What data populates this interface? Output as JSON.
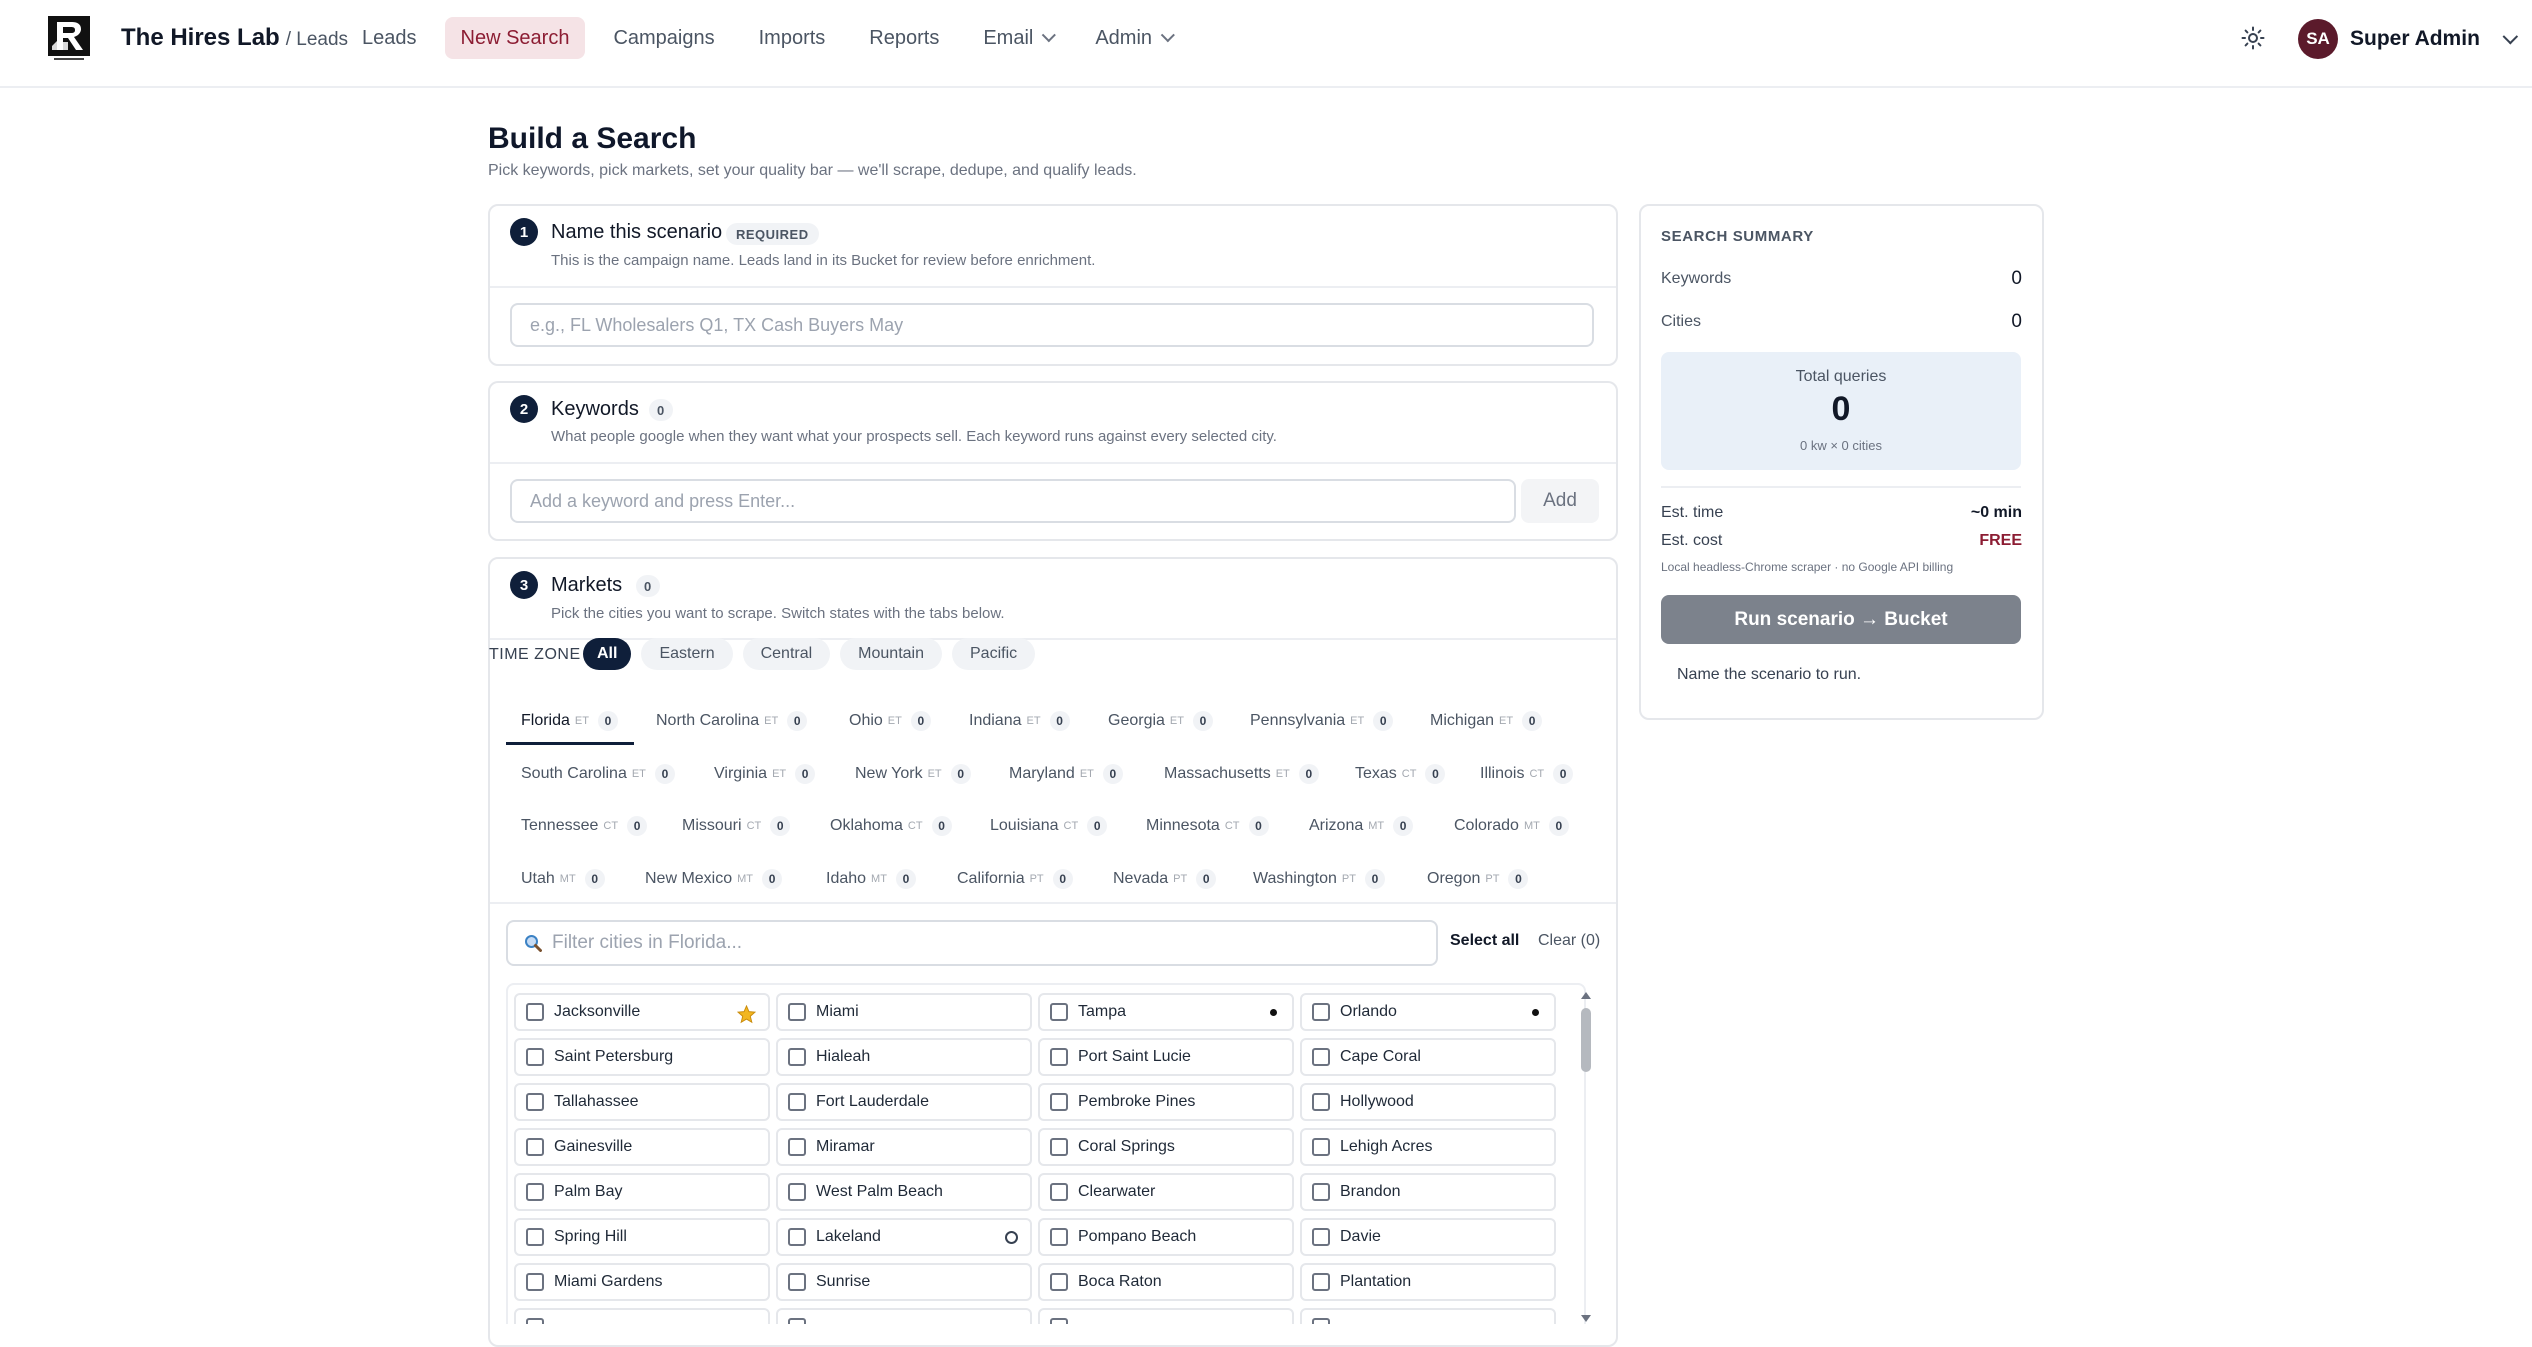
{
  "header": {
    "brand": "The Hires Lab",
    "brand_sub": "/ Leads",
    "nav": [
      {
        "label": "Leads"
      },
      {
        "label": "New Search",
        "active": true
      },
      {
        "label": "Campaigns"
      },
      {
        "label": "Imports"
      },
      {
        "label": "Reports"
      },
      {
        "label": "Email",
        "dropdown": true
      },
      {
        "label": "Admin",
        "dropdown": true
      }
    ],
    "theme_icon": "sun-icon",
    "user": {
      "initials": "SA",
      "name": "Super Admin"
    }
  },
  "page": {
    "title": "Build a Search",
    "subtitle": "Pick keywords, pick markets, set your quality bar — we'll scrape, dedupe, and qualify leads."
  },
  "step1": {
    "num": "1",
    "title": "Name this scenario",
    "badge": "REQUIRED",
    "desc": "This is the campaign name. Leads land in its Bucket for review before enrichment.",
    "placeholder": "e.g., FL Wholesalers Q1, TX Cash Buyers May"
  },
  "step2": {
    "num": "2",
    "title": "Keywords",
    "count": "0",
    "desc": "What people google when they want what your prospects sell. Each keyword runs against every selected city.",
    "placeholder": "Add a keyword and press Enter...",
    "add_label": "Add"
  },
  "step3": {
    "num": "3",
    "title": "Markets",
    "count": "0",
    "desc": "Pick the cities you want to scrape. Switch states with the tabs below.",
    "tz_label": "TIME ZONE",
    "timezones": [
      "All",
      "Eastern",
      "Central",
      "Mountain",
      "Pacific"
    ],
    "states": [
      {
        "name": "Florida",
        "tz": "ET",
        "count": "0"
      },
      {
        "name": "North Carolina",
        "tz": "ET",
        "count": "0"
      },
      {
        "name": "Ohio",
        "tz": "ET",
        "count": "0"
      },
      {
        "name": "Indiana",
        "tz": "ET",
        "count": "0"
      },
      {
        "name": "Georgia",
        "tz": "ET",
        "count": "0"
      },
      {
        "name": "Pennsylvania",
        "tz": "ET",
        "count": "0"
      },
      {
        "name": "Michigan",
        "tz": "ET",
        "count": "0"
      },
      {
        "name": "South Carolina",
        "tz": "ET",
        "count": "0"
      },
      {
        "name": "Virginia",
        "tz": "ET",
        "count": "0"
      },
      {
        "name": "New York",
        "tz": "ET",
        "count": "0"
      },
      {
        "name": "Maryland",
        "tz": "ET",
        "count": "0"
      },
      {
        "name": "Massachusetts",
        "tz": "ET",
        "count": "0"
      },
      {
        "name": "Texas",
        "tz": "CT",
        "count": "0"
      },
      {
        "name": "Illinois",
        "tz": "CT",
        "count": "0"
      },
      {
        "name": "Tennessee",
        "tz": "CT",
        "count": "0"
      },
      {
        "name": "Missouri",
        "tz": "CT",
        "count": "0"
      },
      {
        "name": "Oklahoma",
        "tz": "CT",
        "count": "0"
      },
      {
        "name": "Louisiana",
        "tz": "CT",
        "count": "0"
      },
      {
        "name": "Minnesota",
        "tz": "CT",
        "count": "0"
      },
      {
        "name": "Arizona",
        "tz": "MT",
        "count": "0"
      },
      {
        "name": "Colorado",
        "tz": "MT",
        "count": "0"
      },
      {
        "name": "Utah",
        "tz": "MT",
        "count": "0"
      },
      {
        "name": "New Mexico",
        "tz": "MT",
        "count": "0"
      },
      {
        "name": "Idaho",
        "tz": "MT",
        "count": "0"
      },
      {
        "name": "California",
        "tz": "PT",
        "count": "0"
      },
      {
        "name": "Nevada",
        "tz": "PT",
        "count": "0"
      },
      {
        "name": "Washington",
        "tz": "PT",
        "count": "0"
      },
      {
        "name": "Oregon",
        "tz": "PT",
        "count": "0"
      }
    ],
    "filter_placeholder": "Filter cities in Florida...",
    "select_all": "Select all",
    "clear": "Clear (0)",
    "cities": [
      {
        "name": "Jacksonville",
        "mark": "star-icon"
      },
      {
        "name": "Miami"
      },
      {
        "name": "Tampa",
        "mark": "dot-icon"
      },
      {
        "name": "Orlando",
        "mark": "dot-icon"
      },
      {
        "name": "Saint Petersburg"
      },
      {
        "name": "Hialeah"
      },
      {
        "name": "Port Saint Lucie"
      },
      {
        "name": "Cape Coral"
      },
      {
        "name": "Tallahassee"
      },
      {
        "name": "Fort Lauderdale"
      },
      {
        "name": "Pembroke Pines"
      },
      {
        "name": "Hollywood"
      },
      {
        "name": "Gainesville"
      },
      {
        "name": "Miramar"
      },
      {
        "name": "Coral Springs"
      },
      {
        "name": "Lehigh Acres"
      },
      {
        "name": "Palm Bay"
      },
      {
        "name": "West Palm Beach"
      },
      {
        "name": "Clearwater"
      },
      {
        "name": "Brandon"
      },
      {
        "name": "Spring Hill"
      },
      {
        "name": "Lakeland",
        "mark": "ring-icon"
      },
      {
        "name": "Pompano Beach"
      },
      {
        "name": "Davie"
      },
      {
        "name": "Miami Gardens"
      },
      {
        "name": "Sunrise"
      },
      {
        "name": "Boca Raton"
      },
      {
        "name": "Plantation"
      },
      {
        "name": ""
      },
      {
        "name": ""
      },
      {
        "name": ""
      },
      {
        "name": ""
      }
    ]
  },
  "summary": {
    "heading": "SEARCH SUMMARY",
    "keywords_label": "Keywords",
    "keywords_value": "0",
    "cities_label": "Cities",
    "cities_value": "0",
    "total_label": "Total queries",
    "total_value": "0",
    "total_sub": "0 kw × 0 cities",
    "time_label": "Est. time",
    "time_value": "~0 min",
    "cost_label": "Est. cost",
    "cost_value": "FREE",
    "note": "Local headless-Chrome scraper · no Google API billing",
    "run_label": "Run scenario → Bucket",
    "run_hint": "Name the scenario to run."
  },
  "colors": {
    "accent": "#8c1d33",
    "navy": "#0f1f3a",
    "summary_box": "#e9f0f8",
    "run_button": "#7c828c"
  }
}
